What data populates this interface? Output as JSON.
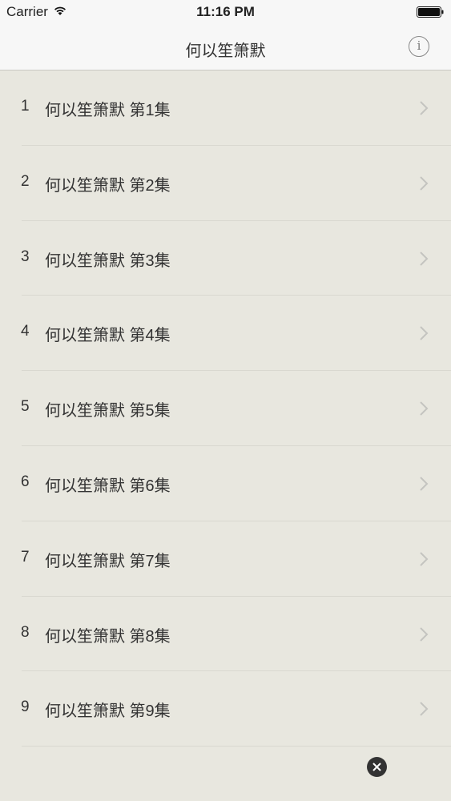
{
  "status_bar": {
    "carrier": "Carrier",
    "time": "11:16 PM",
    "wifi_icon": "wifi-icon",
    "battery_icon": "battery-full-icon"
  },
  "nav_bar": {
    "title": "何以笙箫默",
    "info_icon": "info-icon",
    "info_label": "i"
  },
  "episodes": [
    {
      "number": "1",
      "title": "何以笙箫默 第1集"
    },
    {
      "number": "2",
      "title": "何以笙箫默 第2集"
    },
    {
      "number": "3",
      "title": "何以笙箫默 第3集"
    },
    {
      "number": "4",
      "title": "何以笙箫默 第4集"
    },
    {
      "number": "5",
      "title": "何以笙箫默 第5集"
    },
    {
      "number": "6",
      "title": "何以笙箫默 第6集"
    },
    {
      "number": "7",
      "title": "何以笙箫默 第7集"
    },
    {
      "number": "8",
      "title": "何以笙箫默 第8集"
    },
    {
      "number": "9",
      "title": "何以笙箫默 第9集"
    }
  ],
  "close_icon": "close-circle-icon",
  "colors": {
    "background": "#e8e7df",
    "bar": "#f7f7f7",
    "chevron": "#c4c4c0"
  }
}
